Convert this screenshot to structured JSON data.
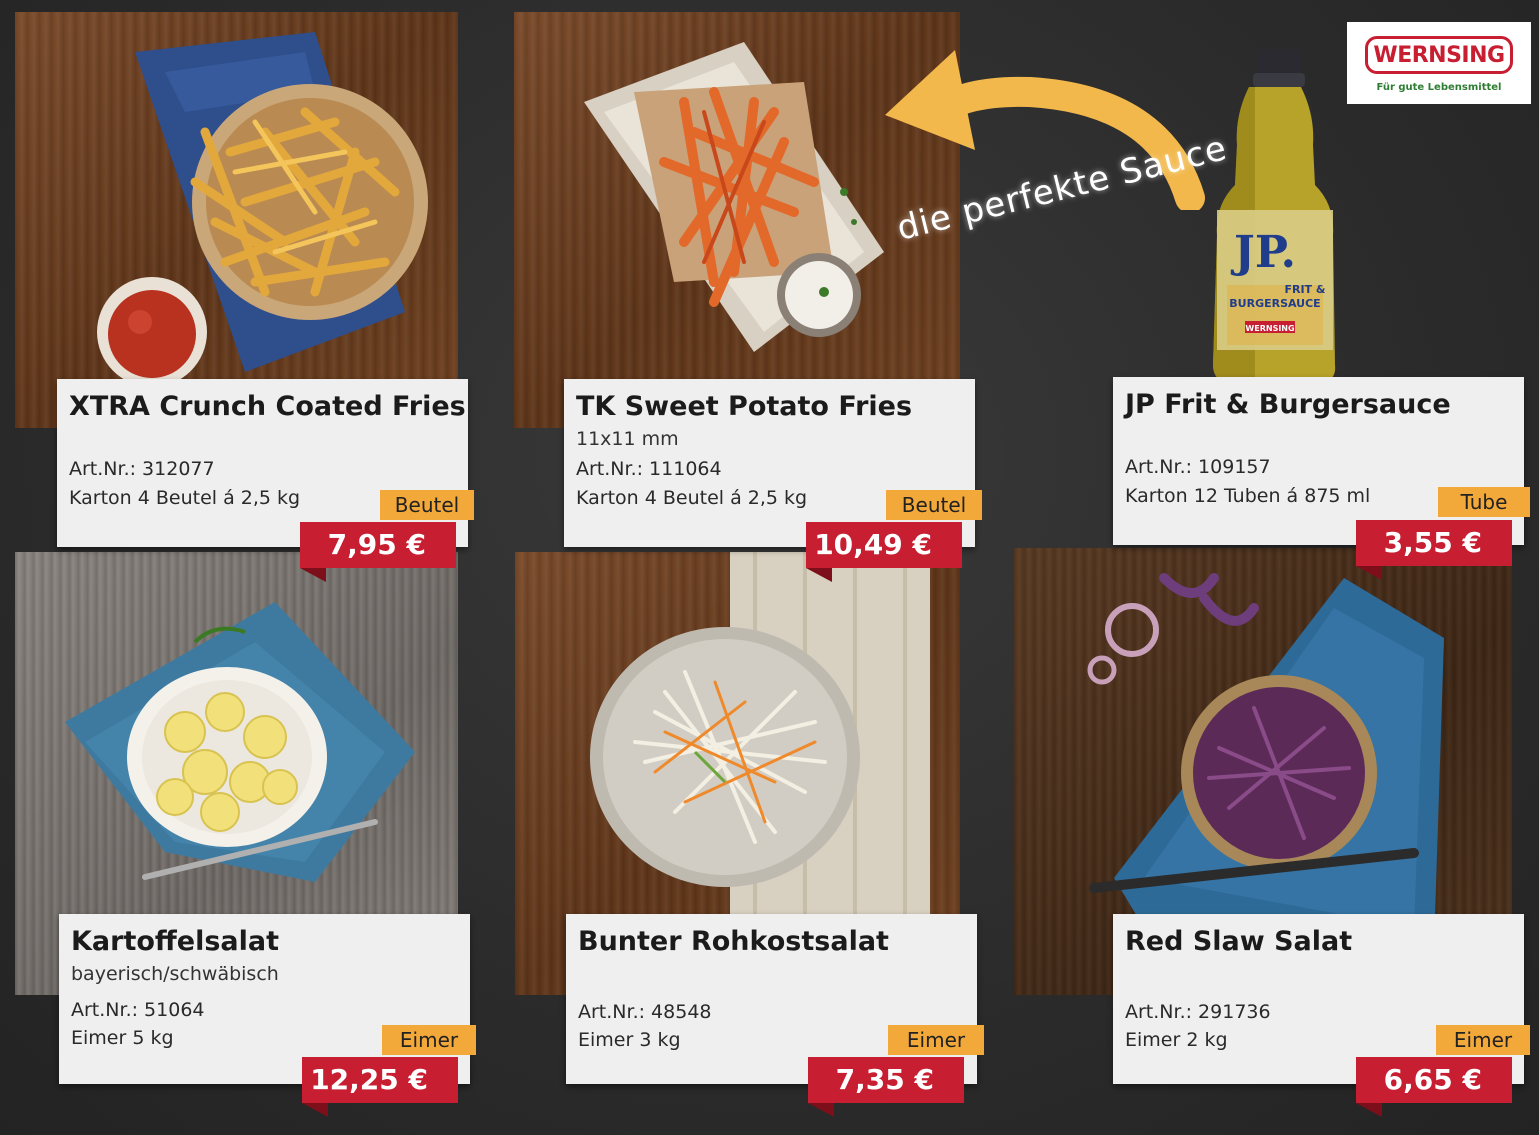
{
  "brand": {
    "name": "WERNSING",
    "tagline": "Für gute Lebensmittel",
    "color": "#c71e31",
    "tagline_color": "#2e7d32"
  },
  "annotation": "die perfekte Sauce",
  "colors": {
    "price_bg": "#c71e31",
    "unit_bg": "#f3a83a",
    "card_bg": "#efefef",
    "background": "#2b2b2b"
  },
  "products": [
    {
      "name": "XTRA Crunch Coated Fries",
      "subtitle": "",
      "art_nr": "Art.Nr.: 312077",
      "pack": "Karton 4 Beutel á 2,5 kg",
      "unit": "Beutel",
      "price": "7,95 €"
    },
    {
      "name": "TK Sweet Potato Fries",
      "subtitle": "11x11 mm",
      "art_nr": "Art.Nr.: 111064",
      "pack": "Karton 4 Beutel á 2,5 kg",
      "unit": "Beutel",
      "price": "10,49 €"
    },
    {
      "name": "JP Frit & Burgersauce",
      "subtitle": "",
      "art_nr": "Art.Nr.: 109157",
      "pack": "Karton 12 Tuben á 875 ml",
      "unit": "Tube",
      "price": "3,55 €"
    },
    {
      "name": "Kartoffelsalat",
      "subtitle": "bayerisch/schwäbisch",
      "art_nr": "Art.Nr.: 51064",
      "pack": "Eimer 5 kg",
      "unit": "Eimer",
      "price": "12,25 €"
    },
    {
      "name": "Bunter Rohkostsalat",
      "subtitle": "",
      "art_nr": "Art.Nr.: 48548",
      "pack": "Eimer 3 kg",
      "unit": "Eimer",
      "price": "7,35 €"
    },
    {
      "name": "Red Slaw Salat",
      "subtitle": "",
      "art_nr": "Art.Nr.: 291736",
      "pack": "Eimer 2 kg",
      "unit": "Eimer",
      "price": "6,65 €"
    }
  ],
  "bottle_label": {
    "brand": "JP.",
    "line1": "FRIT &",
    "line2": "BURGERSAUCE",
    "maker": "WERNSING"
  }
}
